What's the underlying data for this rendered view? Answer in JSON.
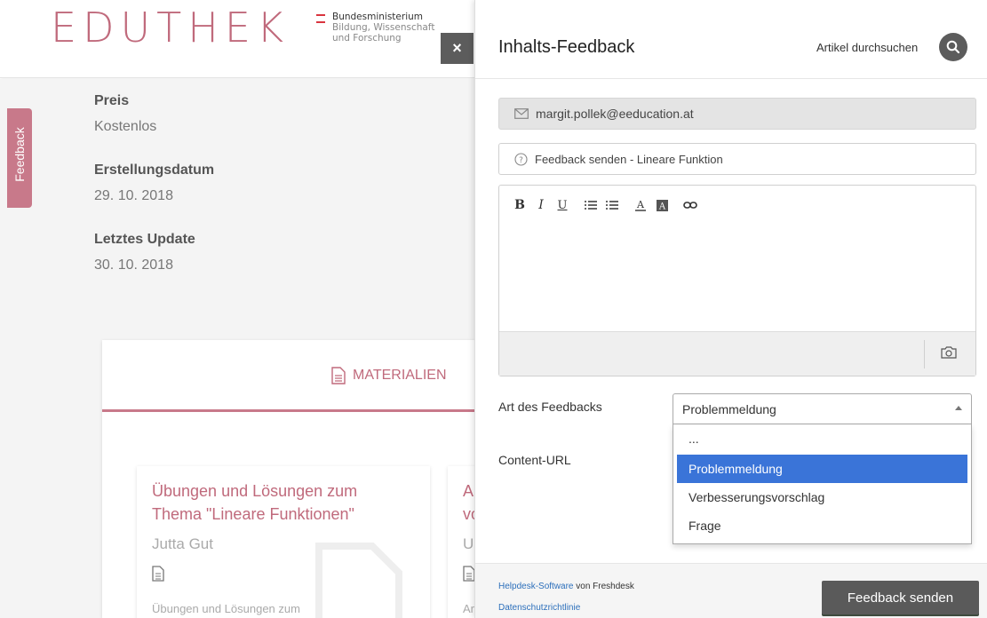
{
  "header": {
    "logo": "EDUTHEK",
    "ministry_line1": "Bundesministerium",
    "ministry_line2": "Bildung, Wissenschaft",
    "ministry_line3": "und Forschung"
  },
  "feedback_tab": {
    "label": "Feedback"
  },
  "meta": {
    "price_label": "Preis",
    "price_value": "Kostenlos",
    "created_label": "Erstellungsdatum",
    "created_value": "29. 10. 2018",
    "updated_label": "Letztes Update",
    "updated_value": "30. 10. 2018"
  },
  "materials": {
    "tab_label": "MATERIALIEN",
    "cards": [
      {
        "title": "Übungen und Lösungen zum Thema \"Lineare Funktionen\"",
        "author": "Jutta Gut",
        "description": "Übungen und Lösungen zum"
      },
      {
        "title": "Ar vo",
        "author": "Ur",
        "description": "Ar"
      }
    ]
  },
  "widget": {
    "close_label": "×",
    "title": "Inhalts-Feedback",
    "search_label": "Artikel durchsuchen",
    "email": "margit.pollek@eeducation.at",
    "subject": "Feedback senden - Lineare Funktion",
    "feedback_type_label": "Art des Feedbacks",
    "content_url_label": "Content-URL",
    "select_value": "Problemmeldung",
    "options": [
      "...",
      "Problemmeldung",
      "Verbesserungsvorschlag",
      "Frage"
    ],
    "selected_index": 1,
    "footer_link": "Helpdesk-Software",
    "footer_text": " von Freshdesk",
    "privacy_link": "Datenschutzrichtlinie",
    "send_button": "Feedback senden",
    "accent_color": "#c06a7c",
    "selection_color": "#3a74d8"
  }
}
